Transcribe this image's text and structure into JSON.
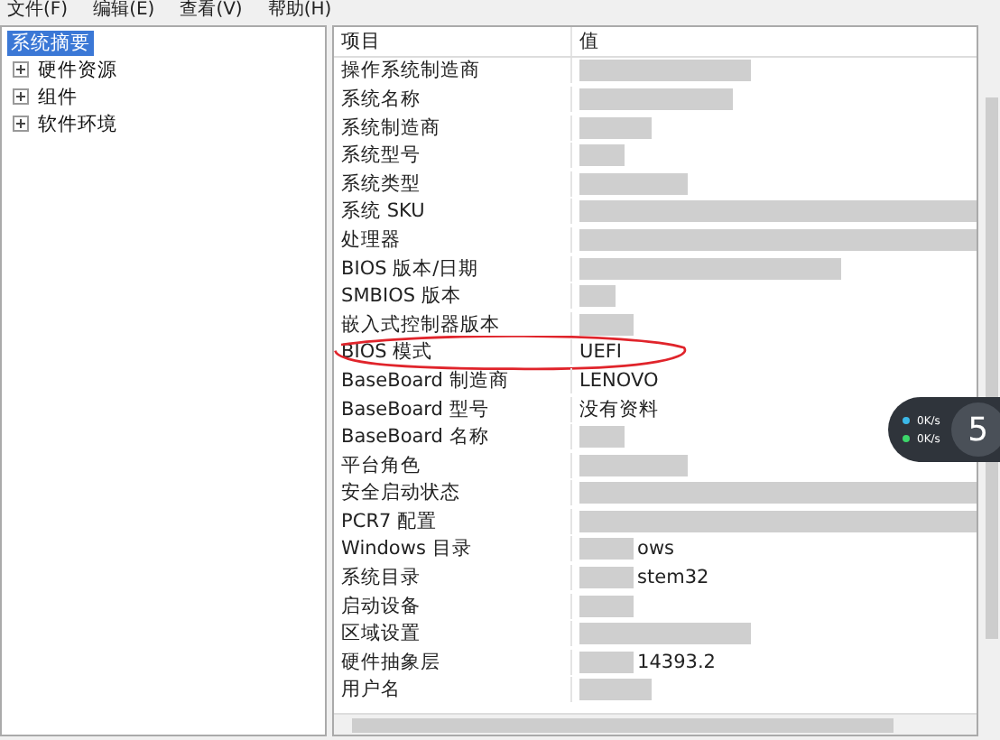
{
  "menu": [
    "文件(F)",
    "编辑(E)",
    "查看(V)",
    "帮助(H)"
  ],
  "tree": [
    {
      "label": "系统摘要",
      "selected": true,
      "expandable": false
    },
    {
      "label": "硬件资源",
      "selected": false,
      "expandable": true
    },
    {
      "label": "组件",
      "selected": false,
      "expandable": true
    },
    {
      "label": "软件环境",
      "selected": false,
      "expandable": true
    }
  ],
  "table": {
    "columns": [
      "项目",
      "值"
    ],
    "rows": [
      {
        "item": "操作系统制造商",
        "blurred": true
      },
      {
        "item": "系统名称",
        "blurred": true
      },
      {
        "item": "系统制造商",
        "blurred": true
      },
      {
        "item": "系统型号",
        "blurred": true
      },
      {
        "item": "系统类型",
        "blurred": true
      },
      {
        "item": "系统 SKU",
        "blurred": true
      },
      {
        "item": "处理器",
        "blurred": true
      },
      {
        "item": "BIOS 版本/日期",
        "blurred": true
      },
      {
        "item": "SMBIOS 版本",
        "blurred": true
      },
      {
        "item": "嵌入式控制器版本",
        "blurred": true
      },
      {
        "item": "BIOS 模式",
        "value": "UEFI",
        "blurred": false,
        "circled": true
      },
      {
        "item": "BaseBoard 制造商",
        "value": "LENOVO",
        "blurred": false
      },
      {
        "item": "BaseBoard 型号",
        "value": "没有资料",
        "blurred": false
      },
      {
        "item": "BaseBoard 名称",
        "blurred": true
      },
      {
        "item": "平台角色",
        "blurred": true
      },
      {
        "item": "安全启动状态",
        "blurred": true
      },
      {
        "item": "PCR7 配置",
        "blurred": true
      },
      {
        "item": "Windows 目录",
        "value": "ows",
        "blurred": true
      },
      {
        "item": "系统目录",
        "value": "stem32",
        "blurred": true
      },
      {
        "item": "启动设备",
        "blurred": true
      },
      {
        "item": "区域设置",
        "blurred": true
      },
      {
        "item": "硬件抽象层",
        "value": "14393.2",
        "blurred": true
      },
      {
        "item": "用户名",
        "blurred": true
      }
    ]
  },
  "speed_widget": {
    "upload": "0K/s",
    "download": "0K/s",
    "gauge": "5"
  }
}
